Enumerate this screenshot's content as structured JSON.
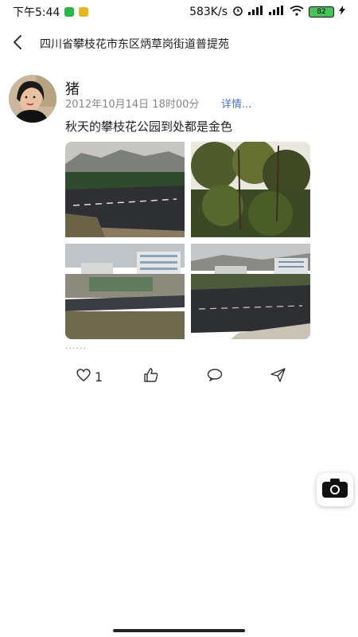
{
  "status_bar": {
    "time": "下午5:44",
    "network_speed": "583K/s",
    "battery_level": "82",
    "icons": [
      "app-notification-icon",
      "message-icon",
      "alarm-icon",
      "hd-signal-icon",
      "hd-signal-icon",
      "wifi-icon",
      "battery-icon",
      "charging-icon"
    ]
  },
  "navbar": {
    "back_icon": "back-arrow-icon",
    "title": "四川省攀枝花市东区炳草岗街道普提苑"
  },
  "post": {
    "username": "猪",
    "date": "2012年10月14日 18时00分",
    "details_link": "详情...",
    "caption": "秋天的攀枝花公园到处都是金色",
    "more": "......",
    "photos": [
      {
        "subject": "mountain road"
      },
      {
        "subject": "trees"
      },
      {
        "subject": "buildings and park"
      },
      {
        "subject": "road and buildings"
      }
    ],
    "actions": {
      "like_icon": "heart-icon",
      "like_count": "1",
      "thumbs_icon": "thumbs-up-icon",
      "comment_icon": "comment-icon",
      "share_icon": "send-icon"
    }
  },
  "fab": {
    "icon": "camera-icon"
  },
  "colors": {
    "accent_link": "#4a76c6",
    "text_primary": "#222222",
    "text_secondary": "#888888"
  }
}
